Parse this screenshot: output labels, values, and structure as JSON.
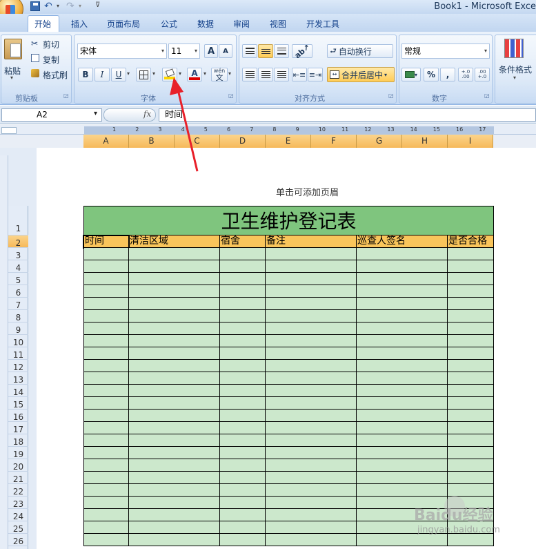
{
  "window": {
    "title": "Book1 - Microsoft Exce"
  },
  "tabs": [
    "开始",
    "插入",
    "页面布局",
    "公式",
    "数据",
    "审阅",
    "视图",
    "开发工具"
  ],
  "ribbon": {
    "clipboard": {
      "paste": "粘贴",
      "cut": "剪切",
      "copy": "复制",
      "format_painter": "格式刷",
      "label": "剪贴板"
    },
    "font": {
      "name": "宋体",
      "size": "11",
      "bold": "B",
      "italic": "I",
      "underline": "U",
      "grow": "A",
      "shrink": "A",
      "font_color": "A",
      "wen": "wén",
      "wen_char": "文",
      "label": "字体"
    },
    "alignment": {
      "wrap": "自动换行",
      "merge": "合并后居中",
      "label": "对齐方式"
    },
    "number": {
      "format": "常规",
      "percent": "%",
      "comma": ",",
      "inc_dec": "+.0 .00",
      "dec_dec": ".00 +.0",
      "label": "数字"
    },
    "styles": {
      "conditional": "条件格式"
    }
  },
  "formula_bar": {
    "name_box": "A2",
    "fx": "fx",
    "value": "时间"
  },
  "ruler_numbers": [
    "1",
    "2",
    "3",
    "4",
    "5",
    "6",
    "7",
    "8",
    "9",
    "10",
    "11",
    "12",
    "13",
    "14",
    "15",
    "16",
    "17"
  ],
  "columns": [
    "A",
    "B",
    "C",
    "D",
    "E",
    "F",
    "G",
    "H",
    "I"
  ],
  "rows": [
    "1",
    "2",
    "3",
    "4",
    "5",
    "6",
    "7",
    "8",
    "9",
    "10",
    "11",
    "12",
    "13",
    "14",
    "15",
    "16",
    "17",
    "18",
    "19",
    "20",
    "21",
    "22",
    "23",
    "24",
    "25",
    "26"
  ],
  "page": {
    "header_hint": "单击可添加页眉"
  },
  "sheet": {
    "title": "卫生维护登记表",
    "headers": [
      "时间",
      "清洁区域",
      "宿舍",
      "备注",
      "巡查人签名",
      "是否合格"
    ]
  },
  "watermark": {
    "text": "Baidu经验",
    "url": "jingyan.baidu.com"
  },
  "colors": {
    "accent_orange": "#f9c55b",
    "title_green": "#7fc57e",
    "cell_green": "#cce8cc",
    "arrow_red": "#e8202a"
  }
}
